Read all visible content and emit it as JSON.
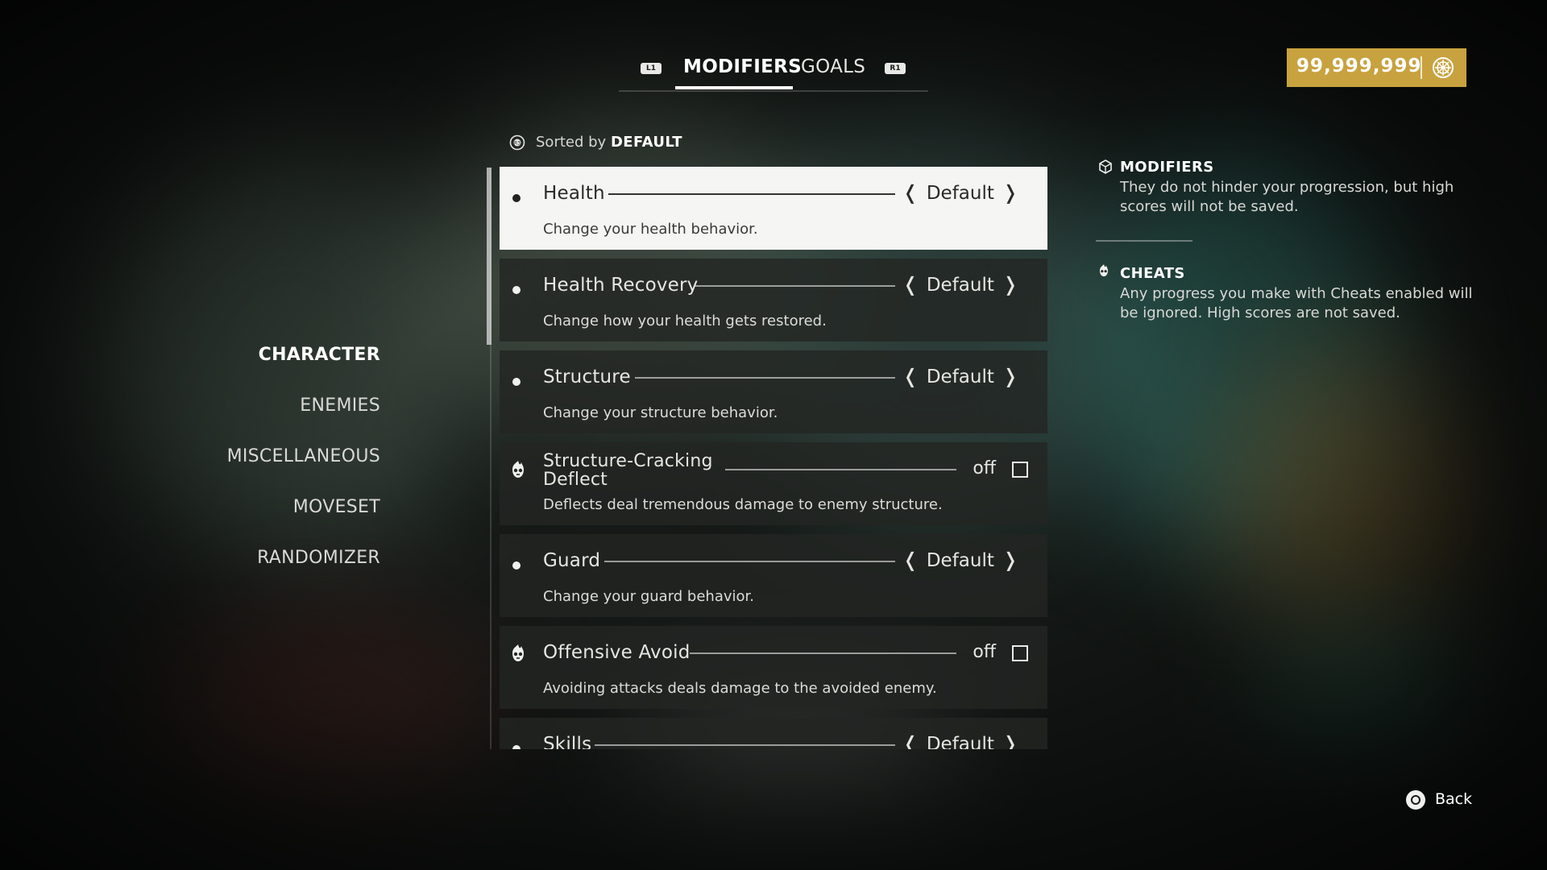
{
  "tabs": {
    "left_button": "L1",
    "right_button": "R1",
    "items": [
      {
        "label": "MODIFIERS",
        "active": true
      },
      {
        "label": "GOALS",
        "active": false
      }
    ]
  },
  "currency": {
    "value": "99,999,999",
    "icon": "coin-emblem-icon",
    "color": "#c8a23e"
  },
  "categories": [
    {
      "label": "CHARACTER",
      "active": true
    },
    {
      "label": "ENEMIES",
      "active": false
    },
    {
      "label": "MISCELLANEOUS",
      "active": false
    },
    {
      "label": "MOVESET",
      "active": false
    },
    {
      "label": "RANDOMIZER",
      "active": false
    }
  ],
  "sort": {
    "prefix": "Sorted by",
    "value": "DEFAULT",
    "button": "R3"
  },
  "modifiers": [
    {
      "name": "Health",
      "type": "modifier",
      "value": "Default",
      "description": "Change your health behavior.",
      "selected": true
    },
    {
      "name": "Health Recovery",
      "type": "modifier",
      "value": "Default",
      "description": "Change how your health gets restored."
    },
    {
      "name": "Structure",
      "type": "modifier",
      "value": "Default",
      "description": "Change your structure behavior."
    },
    {
      "name_line1": "Structure-Cracking",
      "name_line2": "Deflect",
      "type": "cheat",
      "value": "off",
      "checked": false,
      "description": "Deflects deal tremendous damage to enemy structure."
    },
    {
      "name": "Guard",
      "type": "modifier",
      "value": "Default",
      "description": "Change your guard behavior."
    },
    {
      "name": "Offensive Avoid",
      "type": "cheat",
      "value": "off",
      "checked": false,
      "description": "Avoiding attacks deals damage to the avoided enemy."
    },
    {
      "name": "Skills",
      "type": "modifier",
      "value": "Default",
      "description": ""
    }
  ],
  "info": {
    "modifiers_title": "MODIFIERS",
    "modifiers_text": "They do not hinder your progression, but high scores will not be saved.",
    "cheats_title": "CHEATS",
    "cheats_text": "Any progress you make with Cheats enabled will be ignored. High scores are not saved."
  },
  "back": {
    "label": "Back",
    "button": "circle-button-icon"
  },
  "colors": {
    "accent_gold": "#c8a23e",
    "selected_row": "#f5f5f3"
  }
}
